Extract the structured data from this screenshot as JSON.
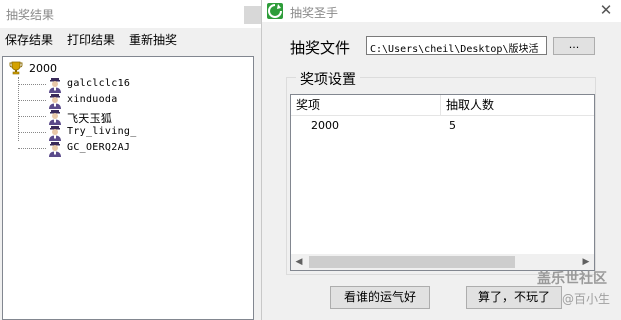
{
  "results_window": {
    "title": "抽奖结果",
    "menu": [
      "保存结果",
      "打印结果",
      "重新抽奖"
    ],
    "tree": {
      "root": "2000",
      "root_icon": "trophy-icon",
      "item_icon": "user-icon",
      "items": [
        "galclclc16",
        "xinduoda",
        "飞天玉狐",
        "Try_living_",
        "GC_OERQ2AJ"
      ]
    }
  },
  "dialog": {
    "title": "抽奖圣手",
    "app_icon": "lottery-app-icon",
    "close_glyph": "✕",
    "file_label": "抽奖文件",
    "file_path": "C:\\Users\\cheil\\Desktop\\版块活",
    "browse_label": "...",
    "group_label": "奖项设置",
    "columns": [
      "奖项",
      "抽取人数"
    ],
    "rows": [
      {
        "prize": "2000",
        "count": "5"
      }
    ],
    "scroll_left": "◀",
    "scroll_right": "▶",
    "lucky_button": "看谁的运气好",
    "quit_button": "算了，不玩了"
  },
  "watermark": {
    "line1": "盖乐世社区",
    "line2": "@百小生"
  },
  "colors": {
    "window_bg": "#f0f0f0",
    "title_text": "#8a8a8a",
    "button_bg": "#e1e1e1",
    "app_icon_green": "#2e9d3a"
  }
}
